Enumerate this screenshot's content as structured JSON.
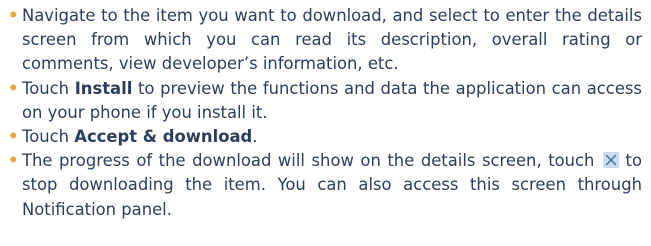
{
  "bullet_symbol": "•",
  "accent_color": "#f1a53a",
  "text_color": "#2b3f5c",
  "items": [
    {
      "text": "Navigate to the item you want to download, and select to enter the details screen from which you can read its description, overall rating or comments, view developer’s information, etc."
    },
    {
      "prefix": "Touch ",
      "bold": "Install",
      "suffix": " to preview the functions and data the application can access on your phone if you install it."
    },
    {
      "prefix": "Touch ",
      "bold": "Accept & download",
      "suffix": "."
    },
    {
      "prefix": "The progress of the download will show on the details screen, touch ",
      "icon": "close-icon",
      "suffix": " to stop downloading the item. You can also access this screen through Notification panel."
    }
  ]
}
